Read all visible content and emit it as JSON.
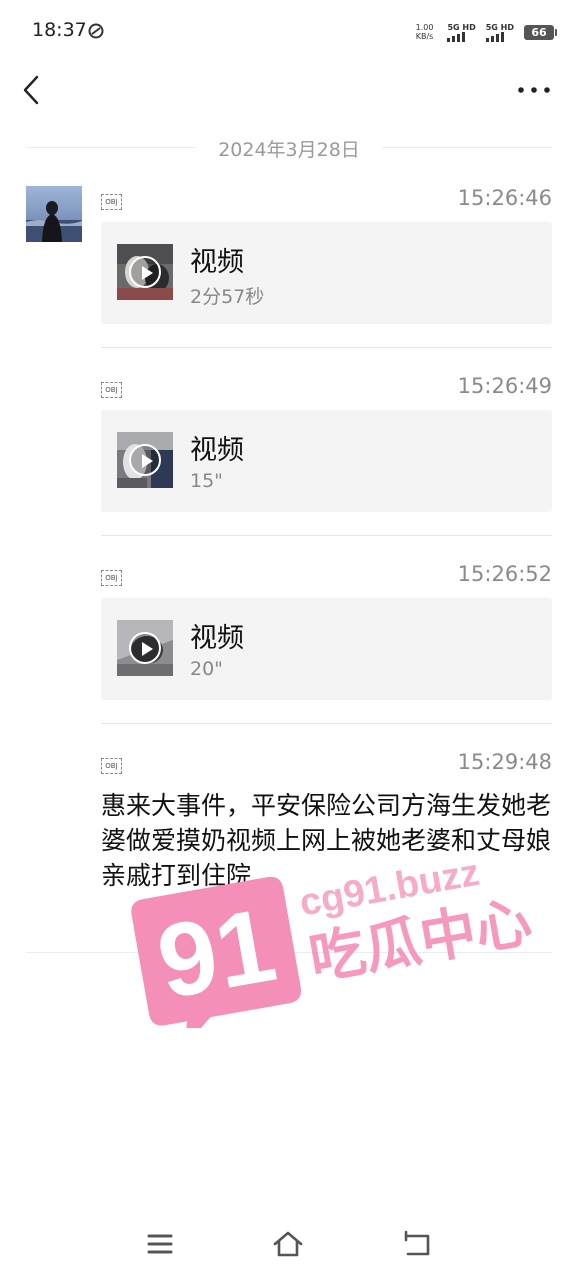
{
  "status_bar": {
    "time": "18:37",
    "net_speed_value": "1.00",
    "net_speed_unit": "KB/s",
    "sim1_label": "5G HD",
    "sim2_label": "5G HD",
    "battery": "66"
  },
  "date_separator": "2024年3月28日",
  "messages": [
    {
      "time": "15:26:46",
      "type": "video",
      "title": "视频",
      "duration": "2分57秒",
      "obj": "OBJ"
    },
    {
      "time": "15:26:49",
      "type": "video",
      "title": "视频",
      "duration": "15\"",
      "obj": "OBJ"
    },
    {
      "time": "15:26:52",
      "type": "video",
      "title": "视频",
      "duration": "20\"",
      "obj": "OBJ"
    },
    {
      "time": "15:29:48",
      "type": "text",
      "text": "惠来大事件，平安保险公司方海生发她老婆做爱摸奶视频上网上被她老婆和丈母娘亲戚打到住院",
      "obj": "OBJ"
    }
  ],
  "watermark": {
    "number": "91",
    "url": "cg91.buzz",
    "label": "吃瓜中心",
    "color": "#f48fb8"
  },
  "icons": {
    "back": "chevron-left-icon",
    "more": "more-horizontal-icon",
    "menu": "menu-icon",
    "home": "home-icon",
    "return": "return-icon"
  }
}
